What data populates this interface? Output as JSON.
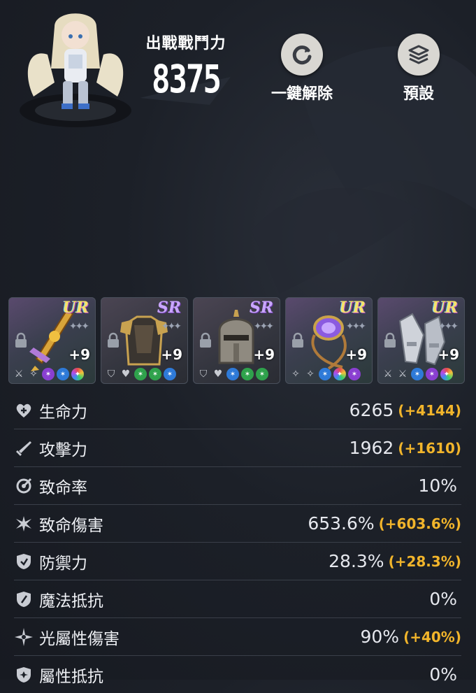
{
  "header": {
    "combat_power_label": "出戰戰鬥力",
    "combat_power_value": "8375",
    "actions": [
      {
        "label": "一鍵解除",
        "icon": "refresh-icon"
      },
      {
        "label": "預設",
        "icon": "layers-icon"
      }
    ]
  },
  "equipment": [
    {
      "rarity": "UR",
      "enhance": "+9",
      "item": "sword",
      "locked": true
    },
    {
      "rarity": "SR",
      "enhance": "+9",
      "item": "armor",
      "locked": true
    },
    {
      "rarity": "SR",
      "enhance": "+9",
      "item": "helmet",
      "locked": true
    },
    {
      "rarity": "UR",
      "enhance": "+9",
      "item": "necklace",
      "locked": true
    },
    {
      "rarity": "UR",
      "enhance": "+9",
      "item": "gauntlets",
      "locked": true
    }
  ],
  "stats": [
    {
      "name": "生命力",
      "value": "6265",
      "bonus": "(+4144)",
      "icon": "heart-plus-icon"
    },
    {
      "name": "攻擊力",
      "value": "1962",
      "bonus": "(+1610)",
      "icon": "sword-icon"
    },
    {
      "name": "致命率",
      "value": "10%",
      "bonus": "",
      "icon": "crit-rate-icon"
    },
    {
      "name": "致命傷害",
      "value": "653.6%",
      "bonus": "(+603.6%)",
      "icon": "crit-damage-icon"
    },
    {
      "name": "防禦力",
      "value": "28.3%",
      "bonus": "(+28.3%)",
      "icon": "shield-icon"
    },
    {
      "name": "魔法抵抗",
      "value": "0%",
      "bonus": "",
      "icon": "magic-shield-icon"
    },
    {
      "name": "光屬性傷害",
      "value": "90%",
      "bonus": "(+40%)",
      "icon": "light-star-icon"
    },
    {
      "name": "屬性抵抗",
      "value": "0%",
      "bonus": "",
      "icon": "element-shield-icon"
    }
  ],
  "colors": {
    "bonus": "#f2b52b",
    "divider": "#3a3f49",
    "background": "#1c2028"
  }
}
